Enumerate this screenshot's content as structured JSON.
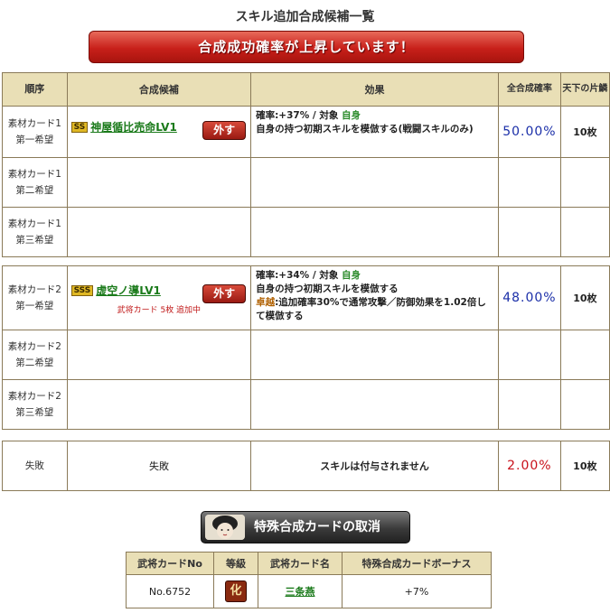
{
  "page": {
    "title": "スキル追加合成候補一覧",
    "banner": "合成成功確率が上昇しています！"
  },
  "headers": {
    "order": "順序",
    "candidate": "合成候補",
    "effect": "効果",
    "rate": "全合成確率",
    "price": "天下の片鱗"
  },
  "groups": [
    {
      "rows": [
        {
          "slot_line1": "素材カード1",
          "slot_line2": "第一希望",
          "rarity": "SS",
          "skill_name": "神屋循比売命LV1",
          "remove_label": "外す",
          "effect_line1_prefix": "確率:+37%  /  対象",
          "effect_target": "自身",
          "effect_line2": "自身の持つ初期スキルを模倣する(戦闘スキルのみ)",
          "rate": "50.00%",
          "price": "10枚"
        },
        {
          "slot_line1": "素材カード1",
          "slot_line2": "第二希望"
        },
        {
          "slot_line1": "素材カード1",
          "slot_line2": "第三希望"
        }
      ]
    },
    {
      "rows": [
        {
          "slot_line1": "素材カード2",
          "slot_line2": "第一希望",
          "rarity": "SSS",
          "skill_name": "虚空ノ導LV1",
          "remove_label": "外す",
          "note": "武将カード 5枚 追加中",
          "effect_line1_prefix": "確率:+34%  /  対象",
          "effect_target": "自身",
          "effect_line2": "自身の持つ初期スキルを模倣する",
          "effect_bonus_label": "卓越",
          "effect_line3": ":追加確率30%で通常攻撃／防御効果を1.02倍して模倣する",
          "rate": "48.00%",
          "price": "10枚"
        },
        {
          "slot_line1": "素材カード2",
          "slot_line2": "第二希望"
        },
        {
          "slot_line1": "素材カード2",
          "slot_line2": "第三希望"
        }
      ]
    }
  ],
  "failure": {
    "slot": "失敗",
    "candidate": "失敗",
    "effect": "スキルは付与されません",
    "rate": "2.00%",
    "price": "10枚"
  },
  "special_button": {
    "label": "特殊合成カードの取消"
  },
  "bonus_table": {
    "headers": [
      "武将カードNo",
      "等級",
      "武将カード名",
      "特殊合成カードボーナス"
    ],
    "row": {
      "card_no": "No.6752",
      "grade": "化",
      "card_name": "三条燕",
      "bonus": "+7%"
    }
  },
  "colors": {
    "header_bg": "#e9dfb6",
    "banner_red": "#c8201a",
    "rate_blue": "#1a2ea8",
    "rate_red": "#c8101a",
    "link_green": "#1a7a1a"
  }
}
